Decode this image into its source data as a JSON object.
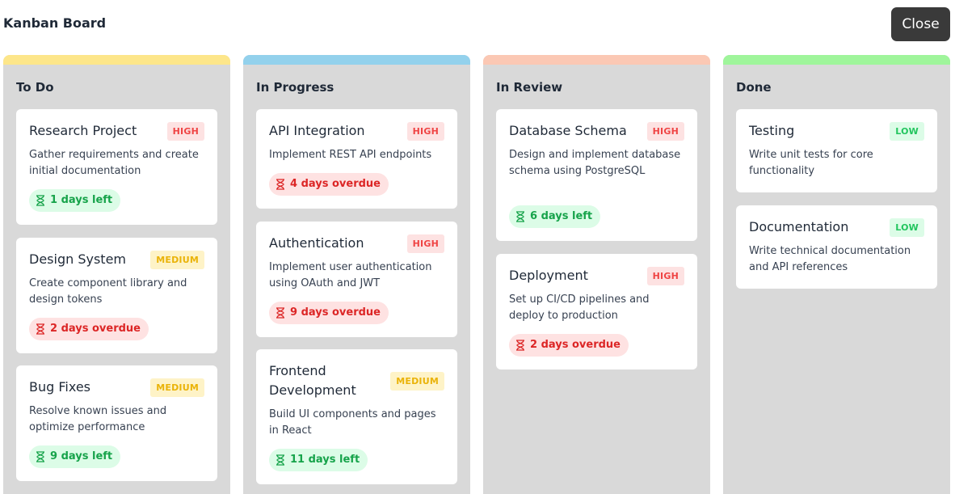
{
  "header": {
    "title": "Kanban Board",
    "close_label": "Close"
  },
  "colors": {
    "todo": "#fde68a",
    "in_progress": "#93d1ec",
    "in_review": "#fbc8b4",
    "done": "#9ff59b"
  },
  "columns": [
    {
      "title": "To Do",
      "cards": [
        {
          "title": "Research Project",
          "priority": "HIGH",
          "description": "Gather requirements and create initial documentation",
          "due": "1 days left"
        },
        {
          "title": "Design System",
          "priority": "MEDIUM",
          "description": "Create component library and design tokens",
          "due": "2 days overdue"
        },
        {
          "title": "Bug Fixes",
          "priority": "MEDIUM",
          "description": "Resolve known issues and optimize performance",
          "due": "9 days left"
        }
      ]
    },
    {
      "title": "In Progress",
      "cards": [
        {
          "title": "API Integration",
          "priority": "HIGH",
          "description": "Implement REST API endpoints",
          "due": "4 days overdue"
        },
        {
          "title": "Authentication",
          "priority": "HIGH",
          "description": "Implement user authentication using OAuth and JWT",
          "due": "9 days overdue"
        },
        {
          "title": "Frontend Development",
          "priority": "MEDIUM",
          "description": "Build UI components and pages in React",
          "due": "11 days left"
        }
      ]
    },
    {
      "title": "In Review",
      "cards": [
        {
          "title": "Database Schema",
          "priority": "HIGH",
          "description": "Design and implement database schema using PostgreSQL",
          "due": "6 days left"
        },
        {
          "title": "Deployment",
          "priority": "HIGH",
          "description": "Set up CI/CD pipelines and deploy to production",
          "due": "2 days overdue"
        }
      ]
    },
    {
      "title": "Done",
      "cards": [
        {
          "title": "Testing",
          "priority": "LOW",
          "description": "Write unit tests for core functionality"
        },
        {
          "title": "Documentation",
          "priority": "LOW",
          "description": "Write technical documentation and API references"
        }
      ]
    }
  ]
}
